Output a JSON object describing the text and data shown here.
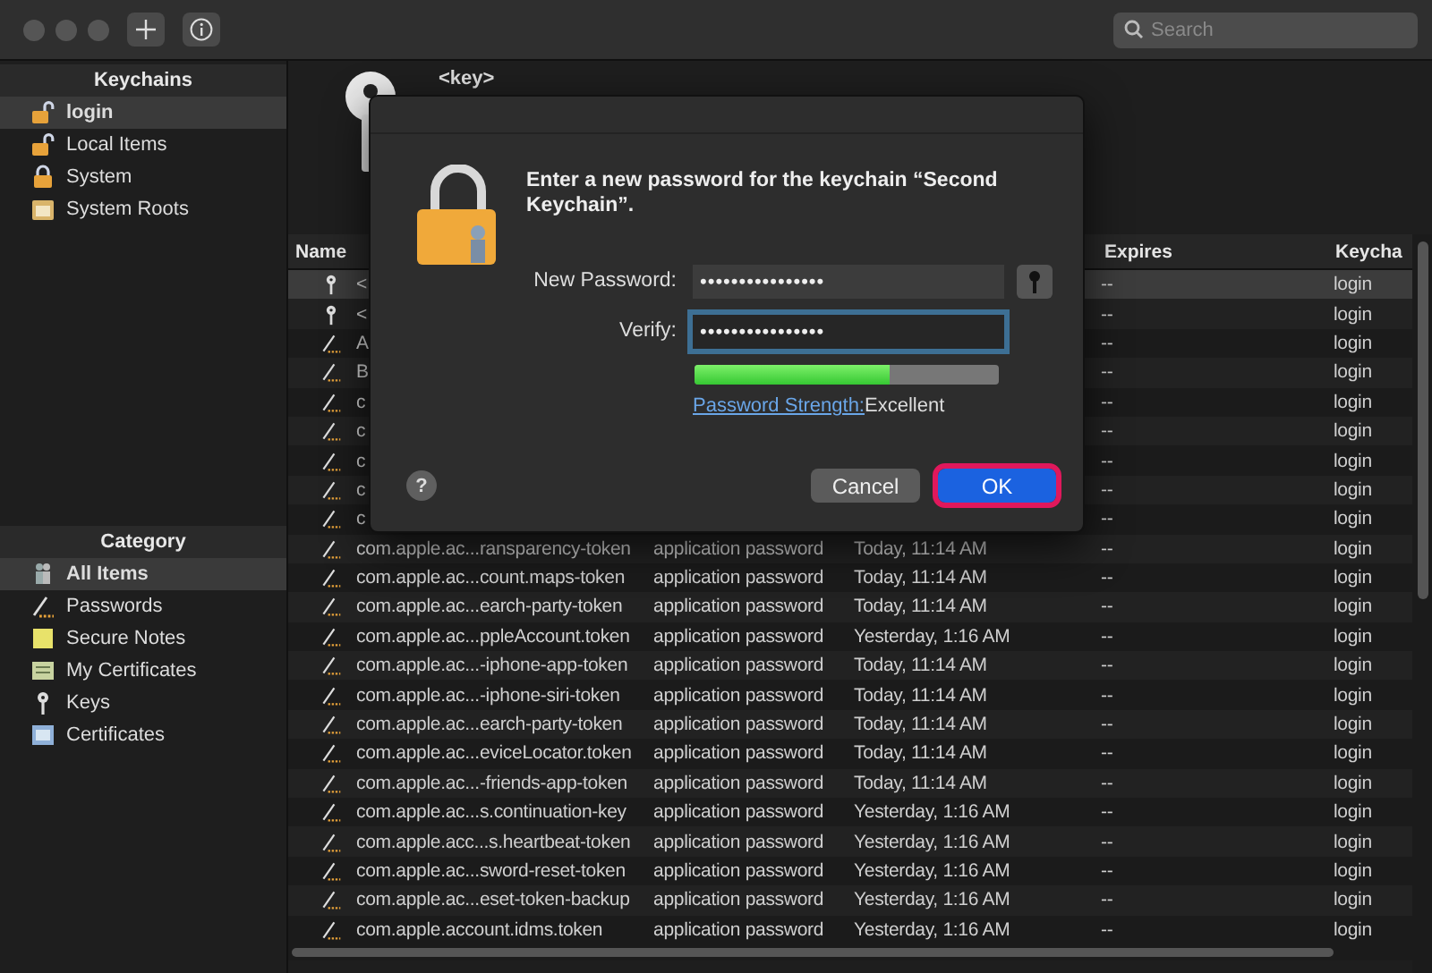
{
  "toolbar": {
    "search": {
      "placeholder": "Search"
    }
  },
  "sidebar": {
    "keychains_title": "Keychains",
    "keychains": [
      {
        "label": "login",
        "kind": "unlocked",
        "selected": true
      },
      {
        "label": "Local Items",
        "kind": "unlocked",
        "selected": false
      },
      {
        "label": "System",
        "kind": "locked",
        "selected": false
      },
      {
        "label": "System Roots",
        "kind": "folder",
        "selected": false
      }
    ],
    "category_title": "Category",
    "categories": [
      {
        "label": "All Items",
        "kind": "people",
        "selected": true
      },
      {
        "label": "Passwords",
        "kind": "password",
        "selected": false
      },
      {
        "label": "Secure Notes",
        "kind": "note",
        "selected": false
      },
      {
        "label": "My Certificates",
        "kind": "mycert",
        "selected": false
      },
      {
        "label": "Keys",
        "kind": "key",
        "selected": false
      },
      {
        "label": "Certificates",
        "kind": "cert",
        "selected": false
      }
    ]
  },
  "item_header": {
    "name": "<key>"
  },
  "table": {
    "columns": [
      "Name",
      "Expires",
      "Keycha"
    ],
    "rows": [
      {
        "kind": "key",
        "name": "<",
        "expires": "--",
        "keychain": "login",
        "selected": true
      },
      {
        "kind": "key",
        "name": "<",
        "expires": "--",
        "keychain": "login",
        "selected": false
      },
      {
        "kind": "password",
        "name": "A",
        "expires": "--",
        "keychain": "login",
        "selected": false
      },
      {
        "kind": "password",
        "name": "B",
        "expires": "--",
        "keychain": "login",
        "selected": false
      },
      {
        "kind": "password",
        "name": "c",
        "expires": "--",
        "keychain": "login",
        "selected": false
      },
      {
        "kind": "password",
        "name": "c",
        "expires": "--",
        "keychain": "login",
        "selected": false
      },
      {
        "kind": "password",
        "name": "c",
        "expires": "--",
        "keychain": "login",
        "selected": false
      },
      {
        "kind": "password",
        "name": "c",
        "expires": "--",
        "keychain": "login",
        "selected": false
      },
      {
        "kind": "password",
        "name": "c",
        "expires": "--",
        "keychain": "login",
        "selected": false
      },
      {
        "kind": "password",
        "name": "com.apple.ac...ransparency-token",
        "type": "application password",
        "date": "Today, 11:14 AM",
        "expires": "--",
        "keychain": "login",
        "selected": false
      },
      {
        "kind": "password",
        "name": "com.apple.ac...count.maps-token",
        "type": "application password",
        "date": "Today, 11:14 AM",
        "expires": "--",
        "keychain": "login",
        "selected": false
      },
      {
        "kind": "password",
        "name": "com.apple.ac...earch-party-token",
        "type": "application password",
        "date": "Today, 11:14 AM",
        "expires": "--",
        "keychain": "login",
        "selected": false
      },
      {
        "kind": "password",
        "name": "com.apple.ac...ppleAccount.token",
        "type": "application password",
        "date": "Yesterday, 1:16 AM",
        "expires": "--",
        "keychain": "login",
        "selected": false
      },
      {
        "kind": "password",
        "name": "com.apple.ac...-iphone-app-token",
        "type": "application password",
        "date": "Today, 11:14 AM",
        "expires": "--",
        "keychain": "login",
        "selected": false
      },
      {
        "kind": "password",
        "name": "com.apple.ac...-iphone-siri-token",
        "type": "application password",
        "date": "Today, 11:14 AM",
        "expires": "--",
        "keychain": "login",
        "selected": false
      },
      {
        "kind": "password",
        "name": "com.apple.ac...earch-party-token",
        "type": "application password",
        "date": "Today, 11:14 AM",
        "expires": "--",
        "keychain": "login",
        "selected": false
      },
      {
        "kind": "password",
        "name": "com.apple.ac...eviceLocator.token",
        "type": "application password",
        "date": "Today, 11:14 AM",
        "expires": "--",
        "keychain": "login",
        "selected": false
      },
      {
        "kind": "password",
        "name": "com.apple.ac...-friends-app-token",
        "type": "application password",
        "date": "Today, 11:14 AM",
        "expires": "--",
        "keychain": "login",
        "selected": false
      },
      {
        "kind": "password",
        "name": "com.apple.ac...s.continuation-key",
        "type": "application password",
        "date": "Yesterday, 1:16 AM",
        "expires": "--",
        "keychain": "login",
        "selected": false
      },
      {
        "kind": "password",
        "name": "com.apple.acc...s.heartbeat-token",
        "type": "application password",
        "date": "Yesterday, 1:16 AM",
        "expires": "--",
        "keychain": "login",
        "selected": false
      },
      {
        "kind": "password",
        "name": "com.apple.ac...sword-reset-token",
        "type": "application password",
        "date": "Yesterday, 1:16 AM",
        "expires": "--",
        "keychain": "login",
        "selected": false
      },
      {
        "kind": "password",
        "name": "com.apple.ac...eset-token-backup",
        "type": "application password",
        "date": "Yesterday, 1:16 AM",
        "expires": "--",
        "keychain": "login",
        "selected": false
      },
      {
        "kind": "password",
        "name": "com.apple.account.idms.token",
        "type": "application password",
        "date": "Yesterday, 1:16 AM",
        "expires": "--",
        "keychain": "login",
        "selected": false
      }
    ]
  },
  "dialog": {
    "message": "Enter a new password for the keychain “Second Keychain”.",
    "new_password": {
      "label": "New Password:",
      "value": "••••••••••••••••"
    },
    "verify": {
      "label": "Verify:",
      "value": "••••••••••••••••",
      "focused": true
    },
    "strength": {
      "level": 0.64,
      "link": "Password Strength:",
      "rating": "Excellent"
    },
    "help": "?",
    "buttons": [
      {
        "label": "Cancel",
        "kind": "secondary",
        "highlighted": false
      },
      {
        "label": "OK",
        "kind": "primary",
        "highlighted": true
      }
    ]
  }
}
